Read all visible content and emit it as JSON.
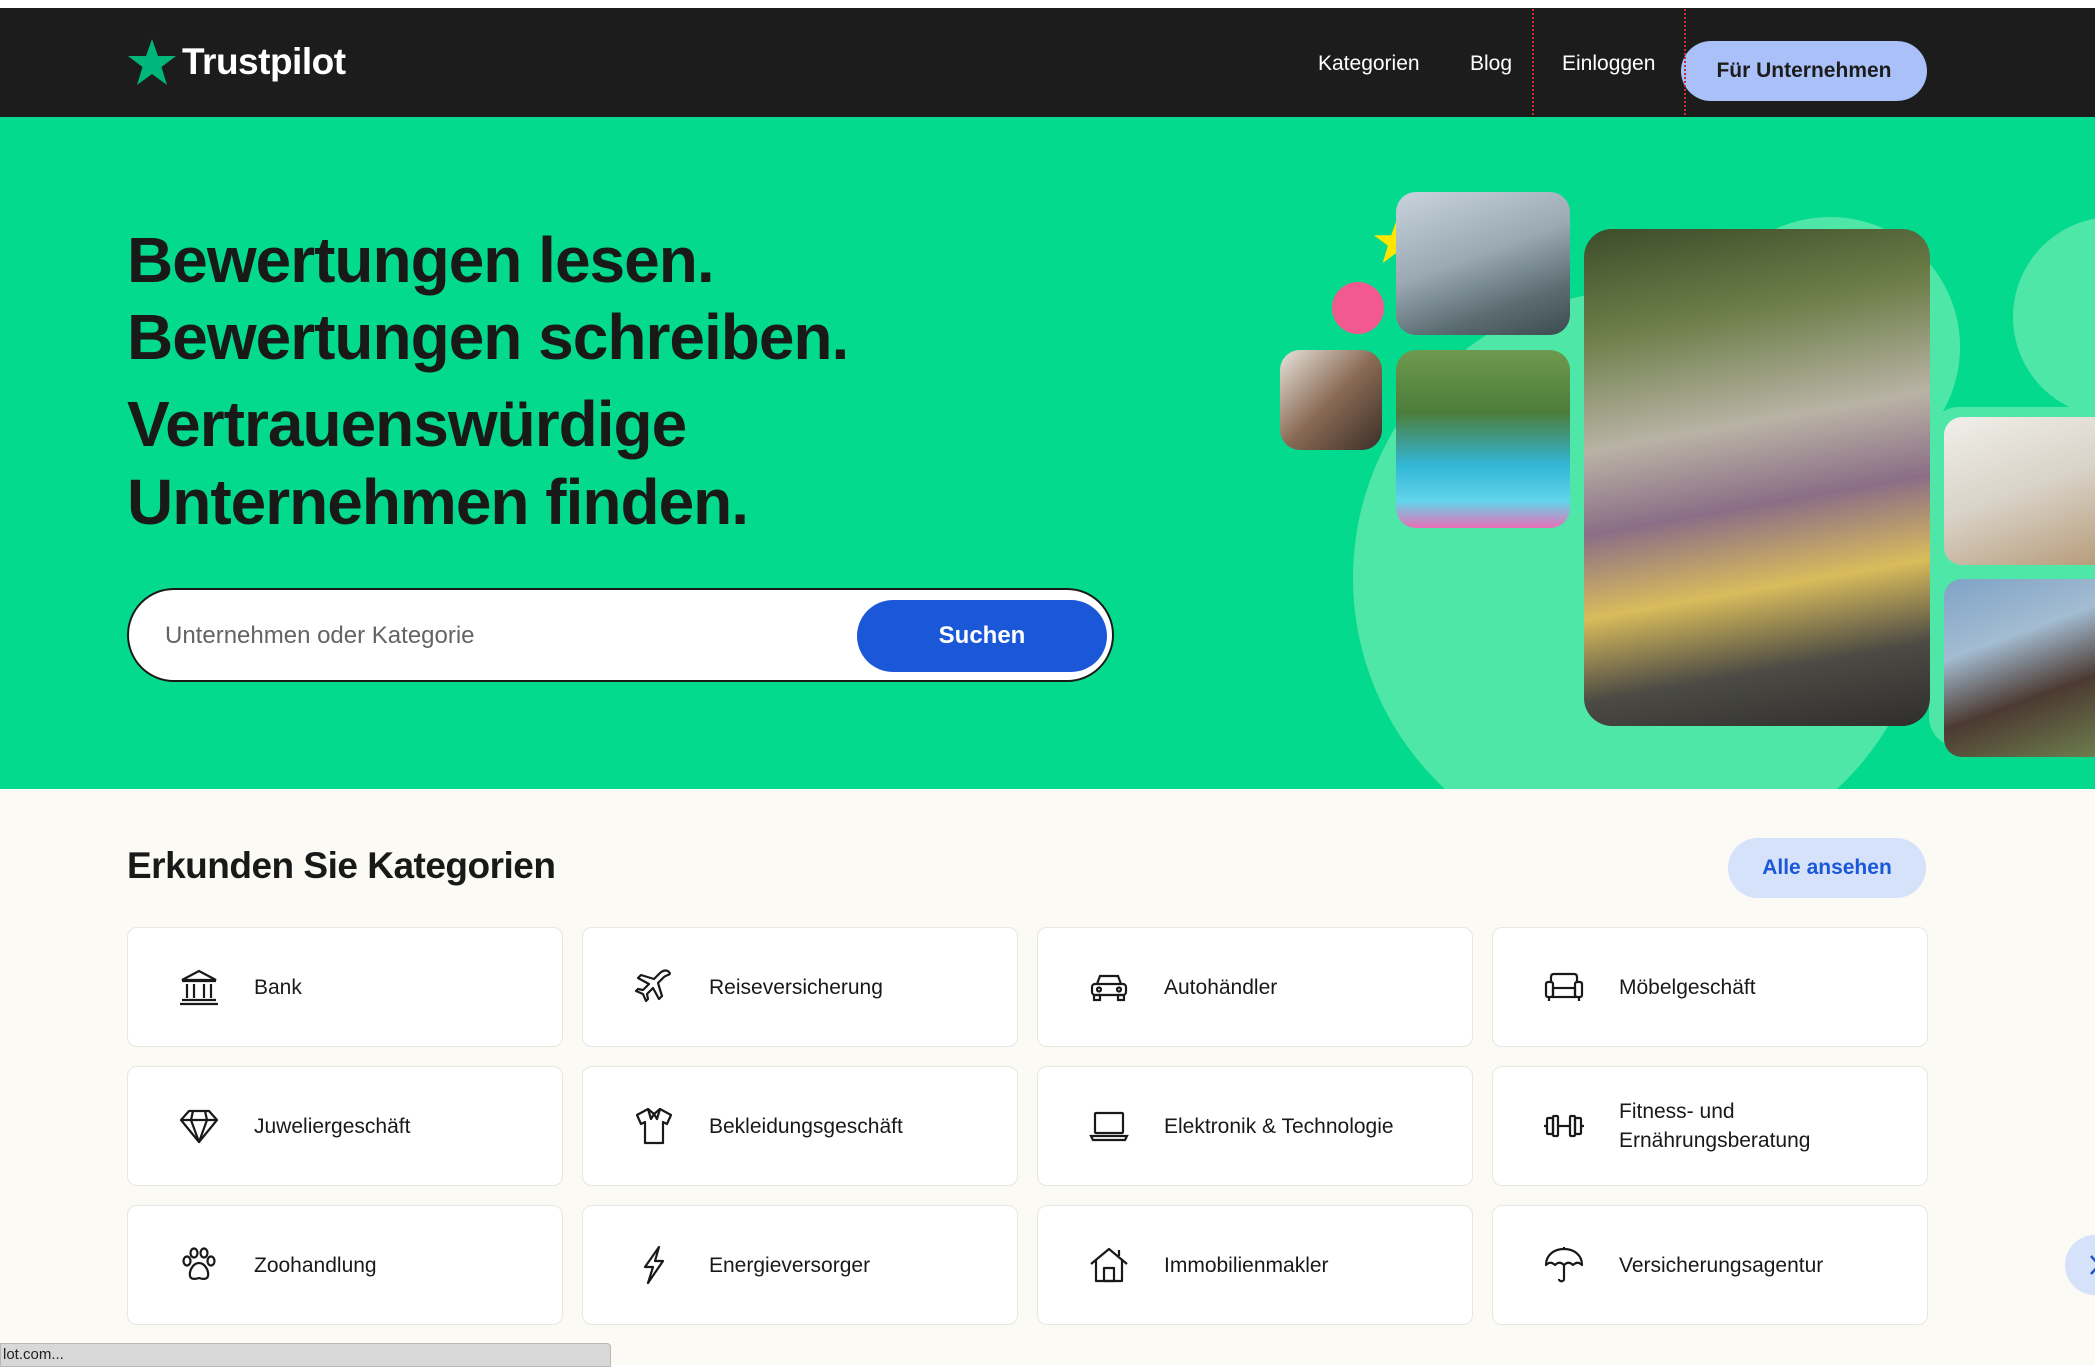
{
  "brand": {
    "name": "Trustpilot",
    "accent": "#00b67a",
    "hero_bg": "#04da8d",
    "primary_blue": "#1b58d8"
  },
  "nav": {
    "links": [
      {
        "label": "Kategorien"
      },
      {
        "label": "Blog"
      },
      {
        "label": "Einloggen"
      }
    ],
    "business_button": "Für Unternehmen"
  },
  "hero": {
    "headline": [
      "Bewertungen lesen.",
      "Bewertungen schreiben.",
      "Vertrauenswürdige",
      "Unternehmen finden."
    ],
    "search_placeholder": "Unternehmen oder Kategorie",
    "search_button": "Suchen"
  },
  "categories": {
    "title": "Erkunden Sie Kategorien",
    "view_all": "Alle ansehen",
    "items": [
      {
        "label": "Bank",
        "icon": "bank-icon"
      },
      {
        "label": "Reiseversicherung",
        "icon": "airplane-icon"
      },
      {
        "label": "Autohändler",
        "icon": "car-icon"
      },
      {
        "label": "Möbelgeschäft",
        "icon": "sofa-icon"
      },
      {
        "label": "Juweliergeschäft",
        "icon": "diamond-icon"
      },
      {
        "label": "Bekleidungsgeschäft",
        "icon": "shirt-icon"
      },
      {
        "label": "Elektronik & Technologie",
        "icon": "laptop-icon"
      },
      {
        "label": "Fitness- und Ernährungsberatung",
        "icon": "dumbbell-icon"
      },
      {
        "label": "Zoohandlung",
        "icon": "paw-icon"
      },
      {
        "label": "Energieversorger",
        "icon": "lightning-icon"
      },
      {
        "label": "Immobilienmakler",
        "icon": "house-icon"
      },
      {
        "label": "Versicherungsagentur",
        "icon": "umbrella-icon"
      }
    ]
  },
  "statusbar": {
    "text": "lot.com..."
  }
}
